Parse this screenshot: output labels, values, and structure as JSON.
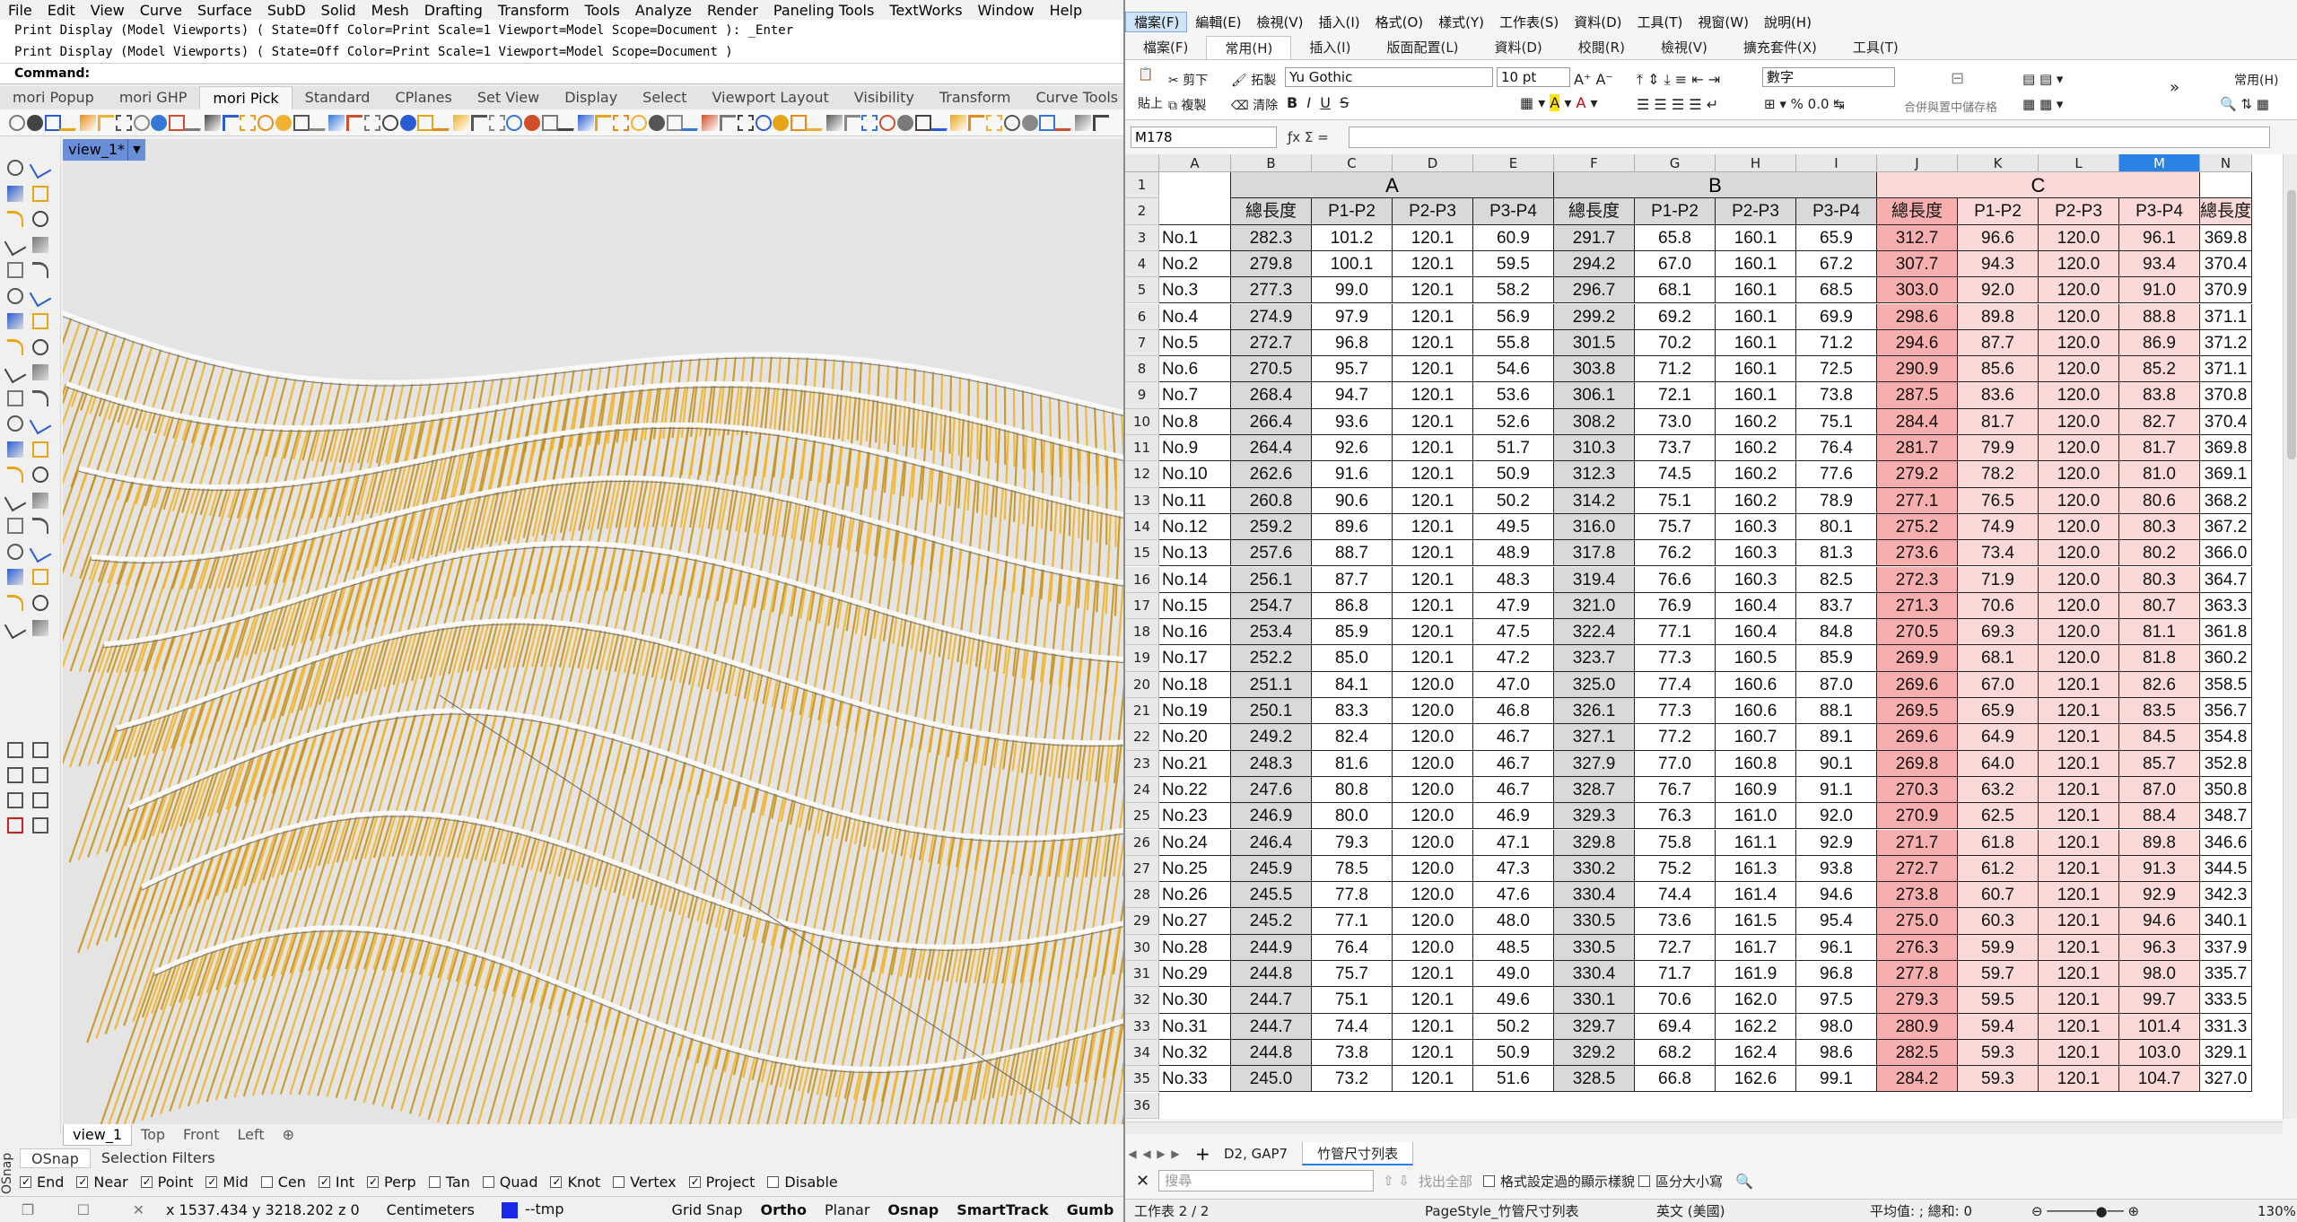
{
  "rhino": {
    "menu": [
      "File",
      "Edit",
      "View",
      "Curve",
      "Surface",
      "SubD",
      "Solid",
      "Mesh",
      "Drafting",
      "Transform",
      "Tools",
      "Analyze",
      "Render",
      "Paneling Tools",
      "TextWorks",
      "Window",
      "Help"
    ],
    "history": [
      "Print Display (Model Viewports) ( State=Off  Color=Print  Scale=1  Viewport=Model  Scope=Document ): _Enter",
      "Print Display (Model Viewports) ( State=Off  Color=Print  Scale=1  Viewport=Model  Scope=Document )"
    ],
    "command_label": "Command:",
    "toolbar_tabs": [
      "mori Popup",
      "mori GHP",
      "mori Pick",
      "Standard",
      "CPlanes",
      "Set View",
      "Display",
      "Select",
      "Viewport Layout",
      "Visibility",
      "Transform",
      "Curve Tools",
      "Surface Tools"
    ],
    "active_toolbar_tab": "mori Pick",
    "viewport_title": "view_1*",
    "viewport_tabs": [
      "view_1",
      "Top",
      "Front",
      "Left",
      "⊕"
    ],
    "osnap_tabs": [
      "OSnap",
      "Selection Filters"
    ],
    "osnap_side_label": "OSnap",
    "osnaps": [
      {
        "label": "End",
        "on": true
      },
      {
        "label": "Near",
        "on": true
      },
      {
        "label": "Point",
        "on": true
      },
      {
        "label": "Mid",
        "on": true
      },
      {
        "label": "Cen",
        "on": false
      },
      {
        "label": "Int",
        "on": true
      },
      {
        "label": "Perp",
        "on": true
      },
      {
        "label": "Tan",
        "on": false
      },
      {
        "label": "Quad",
        "on": false
      },
      {
        "label": "Knot",
        "on": true
      },
      {
        "label": "Vertex",
        "on": false
      },
      {
        "label": "Project",
        "on": true
      },
      {
        "label": "Disable",
        "on": false
      }
    ],
    "status": {
      "coords": "x 1537.434  y 3218.202  z 0",
      "units": "Centimeters",
      "layer": "--tmp",
      "layer_color": "#1a28e8",
      "buttons": [
        {
          "label": "Grid Snap",
          "on": false
        },
        {
          "label": "Ortho",
          "on": true
        },
        {
          "label": "Planar",
          "on": false
        },
        {
          "label": "Osnap",
          "on": true
        },
        {
          "label": "SmartTrack",
          "on": true
        },
        {
          "label": "Gumb",
          "on": true
        }
      ]
    }
  },
  "calc": {
    "menu": [
      "檔案(F)",
      "編輯(E)",
      "檢視(V)",
      "插入(I)",
      "格式(O)",
      "樣式(Y)",
      "工作表(S)",
      "資料(D)",
      "工具(T)",
      "視窗(W)",
      "說明(H)"
    ],
    "tabs": [
      "檔案(F)",
      "常用(H)",
      "插入(I)",
      "版面配置(L)",
      "資料(D)",
      "校閱(R)",
      "檢視(V)",
      "擴充套件(X)",
      "工具(T)"
    ],
    "active_tab": "常用(H)",
    "ribbon": {
      "cut": "剪下",
      "paste": "貼上",
      "copy": "複製",
      "clone": "拓製",
      "clear": "清除",
      "font": "Yu Gothic",
      "size": "10 pt",
      "format": "數字",
      "merge": "合併與置中儲存格",
      "style_menu": "常用(H)"
    },
    "namebox": "M178",
    "fx_label": "ƒx  Σ  =",
    "columns": [
      "A",
      "B",
      "C",
      "D",
      "E",
      "F",
      "G",
      "H",
      "I",
      "J",
      "K",
      "L",
      "M",
      "N"
    ],
    "selected_column": "M",
    "groups": [
      "A",
      "B",
      "C"
    ],
    "subheaders": [
      "總長度",
      "P1-P2",
      "P2-P3",
      "P3-P4"
    ],
    "rows": [
      [
        "No.1",
        "282.3",
        "101.2",
        "120.1",
        "60.9",
        "291.7",
        "65.8",
        "160.1",
        "65.9",
        "312.7",
        "96.6",
        "120.0",
        "96.1",
        "369.8"
      ],
      [
        "No.2",
        "279.8",
        "100.1",
        "120.1",
        "59.5",
        "294.2",
        "67.0",
        "160.1",
        "67.2",
        "307.7",
        "94.3",
        "120.0",
        "93.4",
        "370.4"
      ],
      [
        "No.3",
        "277.3",
        "99.0",
        "120.1",
        "58.2",
        "296.7",
        "68.1",
        "160.1",
        "68.5",
        "303.0",
        "92.0",
        "120.0",
        "91.0",
        "370.9"
      ],
      [
        "No.4",
        "274.9",
        "97.9",
        "120.1",
        "56.9",
        "299.2",
        "69.2",
        "160.1",
        "69.9",
        "298.6",
        "89.8",
        "120.0",
        "88.8",
        "371.1"
      ],
      [
        "No.5",
        "272.7",
        "96.8",
        "120.1",
        "55.8",
        "301.5",
        "70.2",
        "160.1",
        "71.2",
        "294.6",
        "87.7",
        "120.0",
        "86.9",
        "371.2"
      ],
      [
        "No.6",
        "270.5",
        "95.7",
        "120.1",
        "54.6",
        "303.8",
        "71.2",
        "160.1",
        "72.5",
        "290.9",
        "85.6",
        "120.0",
        "85.2",
        "371.1"
      ],
      [
        "No.7",
        "268.4",
        "94.7",
        "120.1",
        "53.6",
        "306.1",
        "72.1",
        "160.1",
        "73.8",
        "287.5",
        "83.6",
        "120.0",
        "83.8",
        "370.8"
      ],
      [
        "No.8",
        "266.4",
        "93.6",
        "120.1",
        "52.6",
        "308.2",
        "73.0",
        "160.2",
        "75.1",
        "284.4",
        "81.7",
        "120.0",
        "82.7",
        "370.4"
      ],
      [
        "No.9",
        "264.4",
        "92.6",
        "120.1",
        "51.7",
        "310.3",
        "73.7",
        "160.2",
        "76.4",
        "281.7",
        "79.9",
        "120.0",
        "81.7",
        "369.8"
      ],
      [
        "No.10",
        "262.6",
        "91.6",
        "120.1",
        "50.9",
        "312.3",
        "74.5",
        "160.2",
        "77.6",
        "279.2",
        "78.2",
        "120.0",
        "81.0",
        "369.1"
      ],
      [
        "No.11",
        "260.8",
        "90.6",
        "120.1",
        "50.2",
        "314.2",
        "75.1",
        "160.2",
        "78.9",
        "277.1",
        "76.5",
        "120.0",
        "80.6",
        "368.2"
      ],
      [
        "No.12",
        "259.2",
        "89.6",
        "120.1",
        "49.5",
        "316.0",
        "75.7",
        "160.3",
        "80.1",
        "275.2",
        "74.9",
        "120.0",
        "80.3",
        "367.2"
      ],
      [
        "No.13",
        "257.6",
        "88.7",
        "120.1",
        "48.9",
        "317.8",
        "76.2",
        "160.3",
        "81.3",
        "273.6",
        "73.4",
        "120.0",
        "80.2",
        "366.0"
      ],
      [
        "No.14",
        "256.1",
        "87.7",
        "120.1",
        "48.3",
        "319.4",
        "76.6",
        "160.3",
        "82.5",
        "272.3",
        "71.9",
        "120.0",
        "80.3",
        "364.7"
      ],
      [
        "No.15",
        "254.7",
        "86.8",
        "120.1",
        "47.9",
        "321.0",
        "76.9",
        "160.4",
        "83.7",
        "271.3",
        "70.6",
        "120.0",
        "80.7",
        "363.3"
      ],
      [
        "No.16",
        "253.4",
        "85.9",
        "120.1",
        "47.5",
        "322.4",
        "77.1",
        "160.4",
        "84.8",
        "270.5",
        "69.3",
        "120.0",
        "81.1",
        "361.8"
      ],
      [
        "No.17",
        "252.2",
        "85.0",
        "120.1",
        "47.2",
        "323.7",
        "77.3",
        "160.5",
        "85.9",
        "269.9",
        "68.1",
        "120.0",
        "81.8",
        "360.2"
      ],
      [
        "No.18",
        "251.1",
        "84.1",
        "120.0",
        "47.0",
        "325.0",
        "77.4",
        "160.6",
        "87.0",
        "269.6",
        "67.0",
        "120.1",
        "82.6",
        "358.5"
      ],
      [
        "No.19",
        "250.1",
        "83.3",
        "120.0",
        "46.8",
        "326.1",
        "77.3",
        "160.6",
        "88.1",
        "269.5",
        "65.9",
        "120.1",
        "83.5",
        "356.7"
      ],
      [
        "No.20",
        "249.2",
        "82.4",
        "120.0",
        "46.7",
        "327.1",
        "77.2",
        "160.7",
        "89.1",
        "269.6",
        "64.9",
        "120.1",
        "84.5",
        "354.8"
      ],
      [
        "No.21",
        "248.3",
        "81.6",
        "120.0",
        "46.7",
        "327.9",
        "77.0",
        "160.8",
        "90.1",
        "269.8",
        "64.0",
        "120.1",
        "85.7",
        "352.8"
      ],
      [
        "No.22",
        "247.6",
        "80.8",
        "120.0",
        "46.7",
        "328.7",
        "76.7",
        "160.9",
        "91.1",
        "270.3",
        "63.2",
        "120.1",
        "87.0",
        "350.8"
      ],
      [
        "No.23",
        "246.9",
        "80.0",
        "120.0",
        "46.9",
        "329.3",
        "76.3",
        "161.0",
        "92.0",
        "270.9",
        "62.5",
        "120.1",
        "88.4",
        "348.7"
      ],
      [
        "No.24",
        "246.4",
        "79.3",
        "120.0",
        "47.1",
        "329.8",
        "75.8",
        "161.1",
        "92.9",
        "271.7",
        "61.8",
        "120.1",
        "89.8",
        "346.6"
      ],
      [
        "No.25",
        "245.9",
        "78.5",
        "120.0",
        "47.3",
        "330.2",
        "75.2",
        "161.3",
        "93.8",
        "272.7",
        "61.2",
        "120.1",
        "91.3",
        "344.5"
      ],
      [
        "No.26",
        "245.5",
        "77.8",
        "120.0",
        "47.6",
        "330.4",
        "74.4",
        "161.4",
        "94.6",
        "273.8",
        "60.7",
        "120.1",
        "92.9",
        "342.3"
      ],
      [
        "No.27",
        "245.2",
        "77.1",
        "120.0",
        "48.0",
        "330.5",
        "73.6",
        "161.5",
        "95.4",
        "275.0",
        "60.3",
        "120.1",
        "94.6",
        "340.1"
      ],
      [
        "No.28",
        "244.9",
        "76.4",
        "120.0",
        "48.5",
        "330.5",
        "72.7",
        "161.7",
        "96.1",
        "276.3",
        "59.9",
        "120.1",
        "96.3",
        "337.9"
      ],
      [
        "No.29",
        "244.8",
        "75.7",
        "120.1",
        "49.0",
        "330.4",
        "71.7",
        "161.9",
        "96.8",
        "277.8",
        "59.7",
        "120.1",
        "98.0",
        "335.7"
      ],
      [
        "No.30",
        "244.7",
        "75.1",
        "120.1",
        "49.6",
        "330.1",
        "70.6",
        "162.0",
        "97.5",
        "279.3",
        "59.5",
        "120.1",
        "99.7",
        "333.5"
      ],
      [
        "No.31",
        "244.7",
        "74.4",
        "120.1",
        "50.2",
        "329.7",
        "69.4",
        "162.2",
        "98.0",
        "280.9",
        "59.4",
        "120.1",
        "101.4",
        "331.3"
      ],
      [
        "No.32",
        "244.8",
        "73.8",
        "120.1",
        "50.9",
        "329.2",
        "68.2",
        "162.4",
        "98.6",
        "282.5",
        "59.3",
        "120.1",
        "103.0",
        "329.1"
      ],
      [
        "No.33",
        "245.0",
        "73.2",
        "120.1",
        "51.6",
        "328.5",
        "66.8",
        "162.6",
        "99.1",
        "284.2",
        "59.3",
        "120.1",
        "104.7",
        "327.0"
      ]
    ],
    "sheet_tabs": [
      "D2, GAP7",
      "竹管尺寸列表"
    ],
    "active_sheet": "竹管尺寸列表",
    "find": {
      "placeholder": "搜尋",
      "find_all": "找出全部",
      "formatted": "格式設定過的顯示樣貌",
      "match_case": "區分大小寫"
    },
    "status": {
      "sheet": "工作表 2 / 2",
      "page_style": "PageStyle_竹管尺寸列表",
      "language": "英文 (美國)",
      "summary": "平均值: ; 總和: 0",
      "zoom": "130%"
    }
  }
}
